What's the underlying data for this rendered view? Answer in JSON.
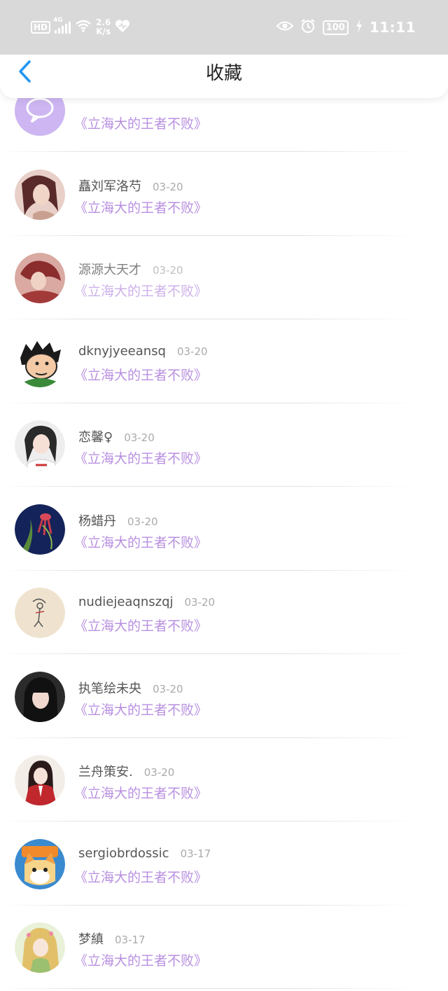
{
  "status_bar": {
    "hd": "HD",
    "network": "4G",
    "speed_value": "2.6",
    "speed_unit": "K/s",
    "battery": "100",
    "time": "11:11",
    "icons": [
      "wifi-icon",
      "heart-icon",
      "eye-icon",
      "alarm-icon",
      "charging-icon"
    ]
  },
  "header": {
    "title": "收藏",
    "back_icon": "chevron-left-icon",
    "accent_color": "#2196f3"
  },
  "items": [
    {
      "name": "",
      "date": "",
      "book": "《立海大的王者不败》"
    },
    {
      "name": "矗刘军洛芍",
      "date": "03-20",
      "book": "《立海大的王者不败》"
    },
    {
      "name": "源源大天才",
      "date": "03-20",
      "book": "《立海大的王者不败》"
    },
    {
      "name": "dknyjyeeansq",
      "date": "03-20",
      "book": "《立海大的王者不败》"
    },
    {
      "name": "恋馨♀",
      "date": "03-20",
      "book": "《立海大的王者不败》"
    },
    {
      "name": "杨蜡丹",
      "date": "03-20",
      "book": "《立海大的王者不败》"
    },
    {
      "name": "nudiejeaqnszqj",
      "date": "03-20",
      "book": "《立海大的王者不败》"
    },
    {
      "name": "执笔绘未央",
      "date": "03-20",
      "book": "《立海大的王者不败》"
    },
    {
      "name": "兰舟策安.",
      "date": "03-20",
      "book": "《立海大的王者不败》"
    },
    {
      "name": "sergiobrdossic",
      "date": "03-17",
      "book": "《立海大的王者不败》"
    },
    {
      "name": "梦縝",
      "date": "03-17",
      "book": "《立海大的王者不败》"
    }
  ],
  "colors": {
    "book_title": "#b88fe0",
    "username": "#555555",
    "date": "#aaaaaa",
    "status_bar_bg": "#d9d9d9"
  }
}
